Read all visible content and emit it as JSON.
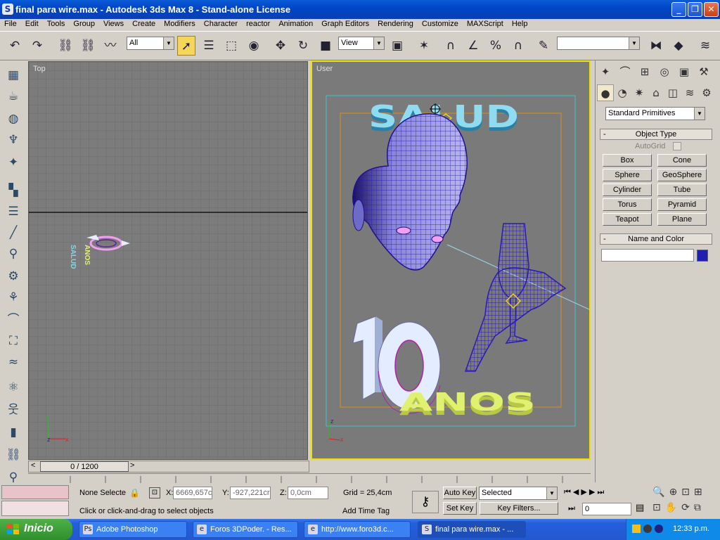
{
  "window": {
    "title": "final para wire.max - Autodesk 3ds Max 8  - Stand-alone License",
    "icon": "3dsmax-icon"
  },
  "menu": [
    "File",
    "Edit",
    "Tools",
    "Group",
    "Views",
    "Create",
    "Modifiers",
    "Character",
    "reactor",
    "Animation",
    "Graph Editors",
    "Rendering",
    "Customize",
    "MAXScript",
    "Help"
  ],
  "toolbar": {
    "selection_filter": "All",
    "ref_coord": "View",
    "named_selection": "",
    "active_tool": "select-object"
  },
  "viewports": {
    "top": {
      "label": "Top"
    },
    "user": {
      "label": "User",
      "text_top": "SALUD",
      "text_bottom": "ANOS",
      "numeral": "10"
    }
  },
  "timeslider": {
    "value": "0 / 1200",
    "prev": "<",
    "next": ">"
  },
  "command_panel": {
    "category": "Standard Primitives",
    "object_type_title": "Object Type",
    "autogrid": "AutoGrid",
    "buttons": [
      "Box",
      "Cone",
      "Sphere",
      "GeoSphere",
      "Cylinder",
      "Tube",
      "Torus",
      "Pyramid",
      "Teapot",
      "Plane"
    ],
    "name_color_title": "Name and Color",
    "name_value": "",
    "object_color": "#2020b0",
    "collapse": "-"
  },
  "status": {
    "selection": "None Selecte",
    "x_label": "X:",
    "x": "6669,657c",
    "y_label": "Y:",
    "y": "-927,221cr",
    "z_label": "Z:",
    "z": "0,0cm",
    "grid": "Grid = 25,4cm",
    "prompt": "Click or click-and-drag to select objects",
    "add_time_tag": "Add Time Tag",
    "auto_key": "Auto Key",
    "set_key": "Set Key",
    "key_mode": "Selected",
    "key_filters": "Key Filters...",
    "frame": "0"
  },
  "taskbar": {
    "start": "Inicio",
    "tasks": [
      {
        "label": "Adobe Photoshop",
        "icon": "photoshop-icon"
      },
      {
        "label": "Foros 3DPoder. - Res...",
        "icon": "browser-icon"
      },
      {
        "label": "http://www.foro3d.c...",
        "icon": "browser-icon"
      },
      {
        "label": "final para wire.max - ...",
        "icon": "3dsmax-icon"
      }
    ],
    "clock": "12:33 p.m."
  },
  "colors": {
    "viewport_bg": "#7a7a7a",
    "active_border": "#f0e000",
    "wire": "#2a1ab8",
    "text_cyan": "#8fdcf0",
    "text_yellow": "#e0f070"
  }
}
